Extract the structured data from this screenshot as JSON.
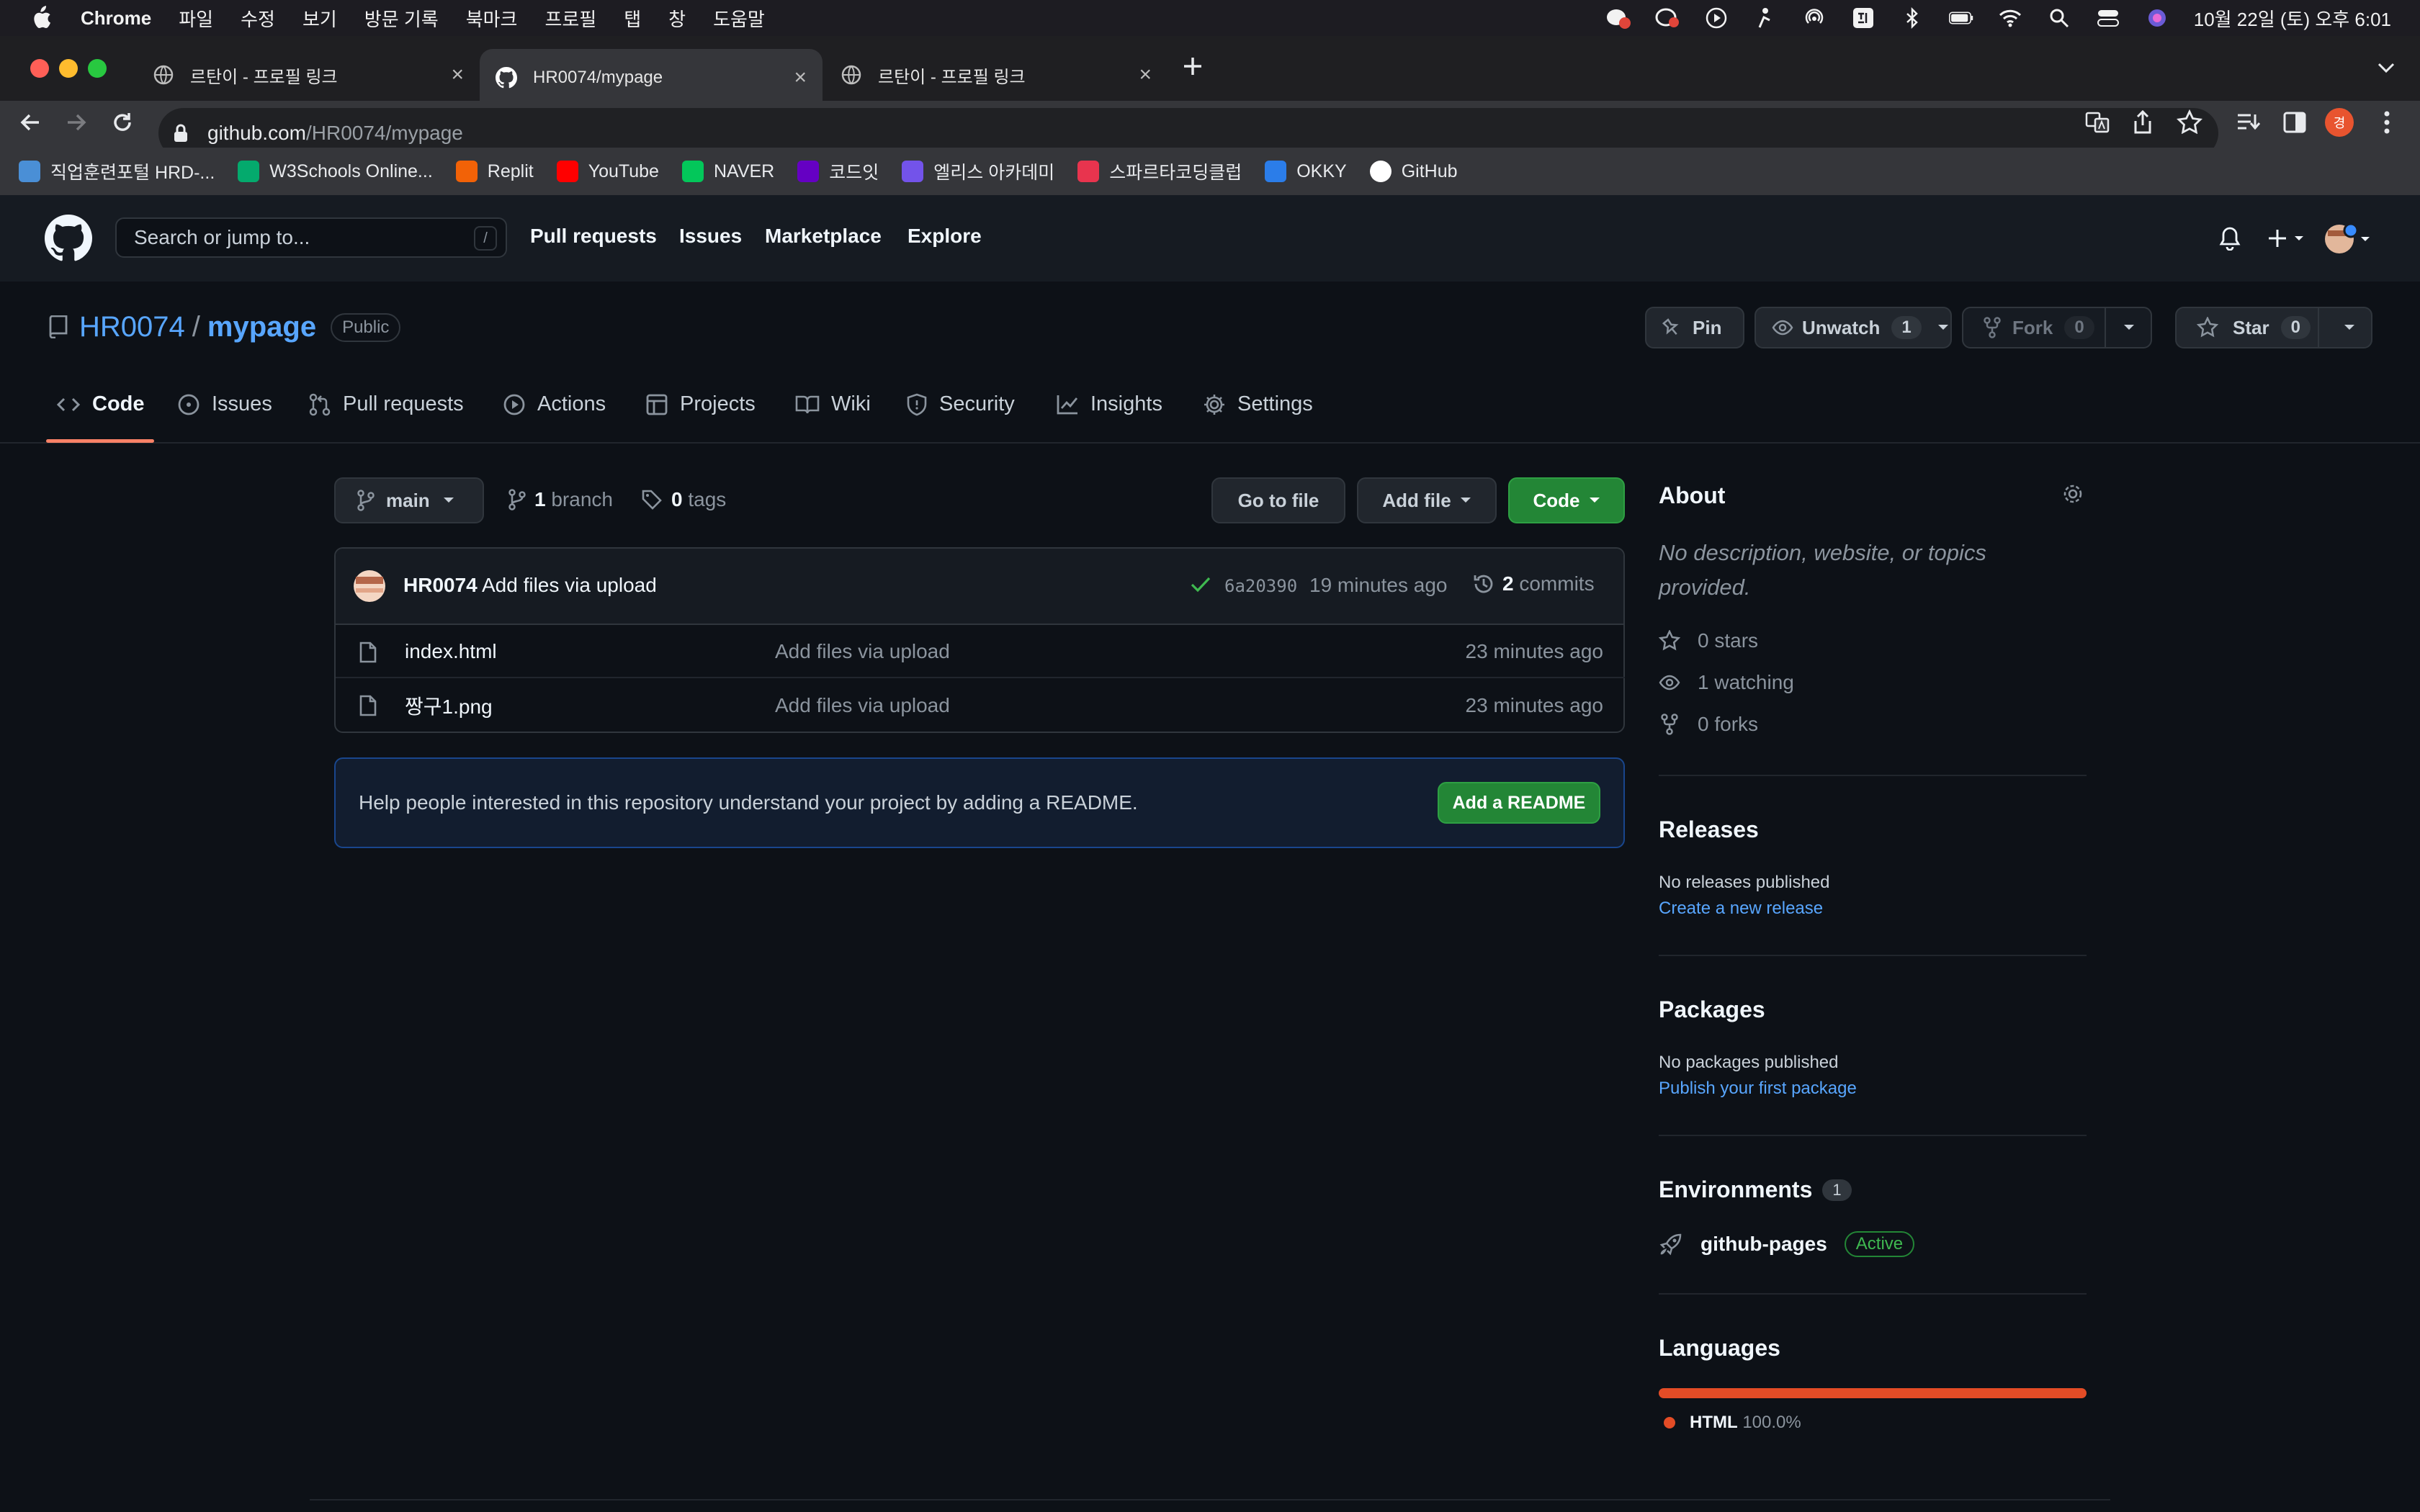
{
  "os_menubar": {
    "app_name": "Chrome",
    "menus": [
      "파일",
      "수정",
      "보기",
      "방문 기록",
      "북마크",
      "프로필",
      "탭",
      "창",
      "도움말"
    ],
    "clock": "10월 22일 (토) 오후 6:01"
  },
  "tabs": [
    {
      "title": "르탄이 - 프로필 링크",
      "active": false
    },
    {
      "title": "HR0074/mypage",
      "active": true
    },
    {
      "title": "르탄이 - 프로필 링크",
      "active": false
    }
  ],
  "address_bar": {
    "domain": "github.com",
    "path": "/HR0074/mypage"
  },
  "profile_initial": "경",
  "bookmarks": [
    {
      "label": "직업훈련포털 HRD-...",
      "icon": "hrd-icon",
      "color": "#4a8fd6"
    },
    {
      "label": "W3Schools Online...",
      "icon": "w3schools-icon",
      "color": "#04aa6d"
    },
    {
      "label": "Replit",
      "icon": "replit-icon",
      "color": "#f26207"
    },
    {
      "label": "YouTube",
      "icon": "youtube-icon",
      "color": "#ff0000"
    },
    {
      "label": "NAVER",
      "icon": "naver-icon",
      "color": "#03c75a"
    },
    {
      "label": "코드잇",
      "icon": "codeit-icon",
      "color": "#6500c3"
    },
    {
      "label": "엘리스 아카데미",
      "icon": "elice-icon",
      "color": "#7353ea"
    },
    {
      "label": "스파르타코딩클럽",
      "icon": "sparta-icon",
      "color": "#e8344e"
    },
    {
      "label": "OKKY",
      "icon": "okky-icon",
      "color": "#2b7de9"
    },
    {
      "label": "GitHub",
      "icon": "github-icon",
      "color": "#ffffff"
    }
  ],
  "gh_header": {
    "search_placeholder": "Search or jump to...",
    "search_shortcut": "/",
    "nav": [
      "Pull requests",
      "Issues",
      "Marketplace",
      "Explore"
    ]
  },
  "repo": {
    "owner": "HR0074",
    "name": "mypage",
    "visibility": "Public",
    "pin_label": "Pin",
    "unwatch_label": "Unwatch",
    "watch_count": "1",
    "fork_label": "Fork",
    "fork_count": "0",
    "star_label": "Star",
    "star_count": "0"
  },
  "repo_tabs": [
    "Code",
    "Issues",
    "Pull requests",
    "Actions",
    "Projects",
    "Wiki",
    "Security",
    "Insights",
    "Settings"
  ],
  "branch_bar": {
    "branch": "main",
    "branch_count": "1",
    "branch_word": "branch",
    "tag_count": "0",
    "tag_word": "tags",
    "go_to_file": "Go to file",
    "add_file": "Add file",
    "code": "Code"
  },
  "commit": {
    "author": "HR0074",
    "message": "Add files via upload",
    "sha": "6a20390",
    "time": "19 minutes ago",
    "count": "2",
    "count_word": "commits"
  },
  "files": [
    {
      "name": "index.html",
      "message": "Add files via upload",
      "time": "23 minutes ago"
    },
    {
      "name": "짱구1.png",
      "message": "Add files via upload",
      "time": "23 minutes ago"
    }
  ],
  "readme_prompt": {
    "text": "Help people interested in this repository understand your project by adding a README.",
    "button": "Add a README"
  },
  "about": {
    "heading": "About",
    "description": "No description, website, or topics provided.",
    "stars": "0 stars",
    "watching": "1 watching",
    "forks": "0 forks"
  },
  "releases": {
    "heading": "Releases",
    "empty": "No releases published",
    "link": "Create a new release"
  },
  "packages": {
    "heading": "Packages",
    "empty": "No packages published",
    "link": "Publish your first package"
  },
  "environments": {
    "heading": "Environments",
    "count": "1",
    "name": "github-pages",
    "status": "Active"
  },
  "languages": {
    "heading": "Languages",
    "items": [
      {
        "name": "HTML",
        "percent_label": "100.0%",
        "share": 1.0,
        "color": "#e34c26"
      }
    ]
  }
}
